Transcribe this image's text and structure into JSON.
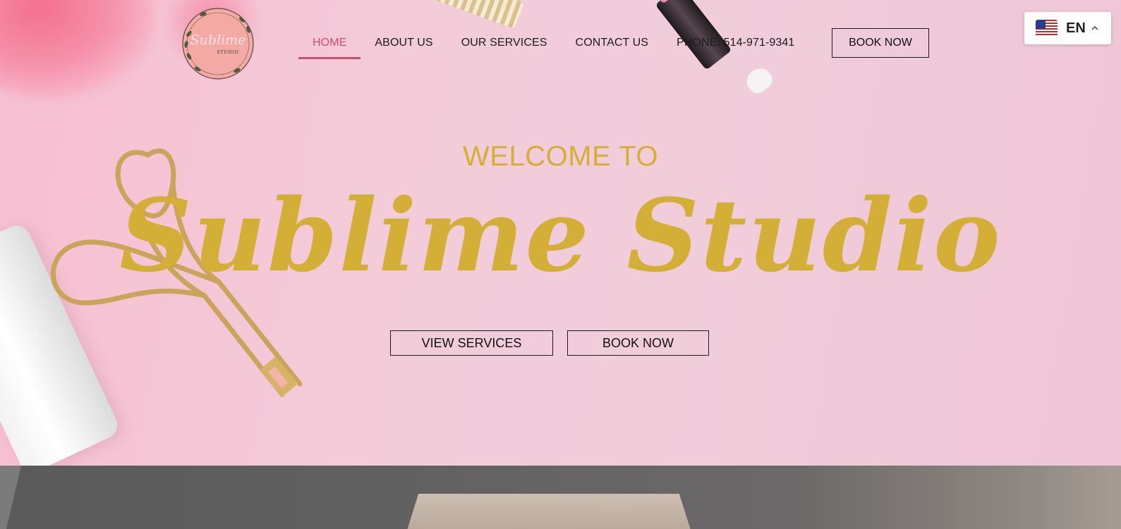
{
  "header": {
    "logo": {
      "script": "Sublime",
      "caption": "STUDIO"
    },
    "nav": [
      {
        "label": "HOME",
        "active": true
      },
      {
        "label": "ABOUT US",
        "active": false
      },
      {
        "label": "OUR SERVICES",
        "active": false
      },
      {
        "label": "CONTACT US",
        "active": false
      },
      {
        "label": "PHONE: 514-971-9341",
        "active": false
      }
    ],
    "book_label": "BOOK NOW"
  },
  "language": {
    "code": "EN",
    "flag_icon": "us-flag-icon",
    "chevron_icon": "chevron-up-icon"
  },
  "hero": {
    "welcome": "WELCOME TO",
    "brand": "Sublime Studio",
    "buttons": {
      "view_services": "VIEW SERVICES",
      "book_now": "BOOK NOW"
    }
  },
  "colors": {
    "accent_gold": "#d4af37",
    "nav_active": "#c94f72",
    "hero_pink": "#f2c9d8",
    "text_dark": "#1b1b1b"
  }
}
